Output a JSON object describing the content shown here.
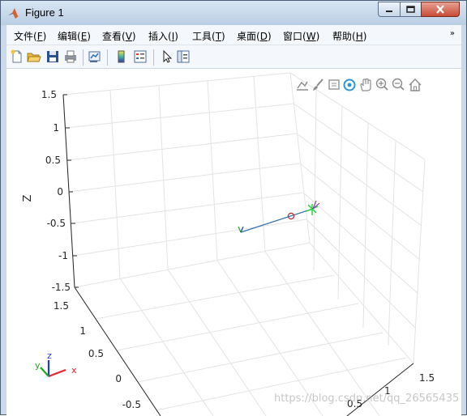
{
  "window": {
    "title": "Figure 1"
  },
  "menubar": {
    "items": [
      {
        "label": "文件(",
        "key": "F",
        "end": ")"
      },
      {
        "label": "编辑(",
        "key": "E",
        "end": ")"
      },
      {
        "label": "查看(",
        "key": "V",
        "end": ")"
      },
      {
        "label": "插入(",
        "key": "I",
        "end": ")"
      },
      {
        "label": "工具(",
        "key": "T",
        "end": ")"
      },
      {
        "label": "桌面(",
        "key": "D",
        "end": ")"
      },
      {
        "label": "窗口(",
        "key": "W",
        "end": ")"
      },
      {
        "label": "帮助(",
        "key": "H",
        "end": ")"
      }
    ],
    "overflow_glyph": "»"
  },
  "toolbar": {
    "buttons": [
      "new-figure-icon",
      "open-folder-icon",
      "save-icon",
      "print-icon",
      "link-plot-icon",
      "insert-colorbar-icon",
      "insert-legend-icon",
      "edit-plot-arrow-icon",
      "property-inspector-icon"
    ]
  },
  "axes_toolbar": {
    "buttons": [
      "export-icon",
      "brush-icon",
      "data-tips-icon",
      "rotate-3d-icon",
      "pan-icon",
      "zoom-in-icon",
      "zoom-out-icon",
      "home-icon"
    ]
  },
  "plot": {
    "z_label": "Z",
    "z_ticks": [
      "1.5",
      "1",
      "0.5",
      "0",
      "-0.5",
      "-1",
      "-1.5"
    ],
    "left_ticks": [
      "1.5",
      "1",
      "0.5",
      "0",
      "-0.5"
    ],
    "right_ticks": [
      "1.5",
      "1",
      "0.5"
    ],
    "triad": {
      "x": "x",
      "y": "y",
      "z": "z"
    }
  },
  "watermark": "https://blog.csdn.net/qq_26565435",
  "colors": {
    "segment": "#2e6fae",
    "start_marker": "#c0282d",
    "end_marker": "#1fcf37",
    "triad_x": "#e8232b",
    "triad_y": "#1ea81e",
    "triad_z": "#1e3bd6",
    "grid": "#e3e3e3",
    "axis": "#262626"
  }
}
